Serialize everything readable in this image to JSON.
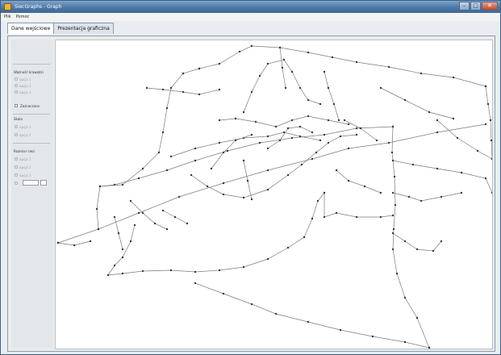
{
  "window": {
    "title": "SiecGraphs - Graph"
  },
  "menu": [
    {
      "label": "Plik"
    },
    {
      "label": "Pomoc"
    }
  ],
  "tabs": [
    {
      "label": "Dane wejściowe",
      "active": true
    },
    {
      "label": "Prezentacja graficzna",
      "active": false
    }
  ],
  "sidebar": {
    "group1_title": "Ważność krawędzi",
    "group1_options": [
      "opcja 1",
      "opcja 2",
      "opcja 3"
    ],
    "checkbox_label": "Zaznaczone",
    "group2_title": "Skala",
    "group2_options": [
      "opcja 1",
      "opcja 2"
    ],
    "group3_title": "Rozmiar sieci",
    "group3_options": [
      "opcja 1",
      "opcja 2",
      "opcja 3"
    ]
  },
  "colors": {
    "edge": "#7a7a7a",
    "node": "#3a3a3a",
    "titlebar": "#4d78a6"
  }
}
